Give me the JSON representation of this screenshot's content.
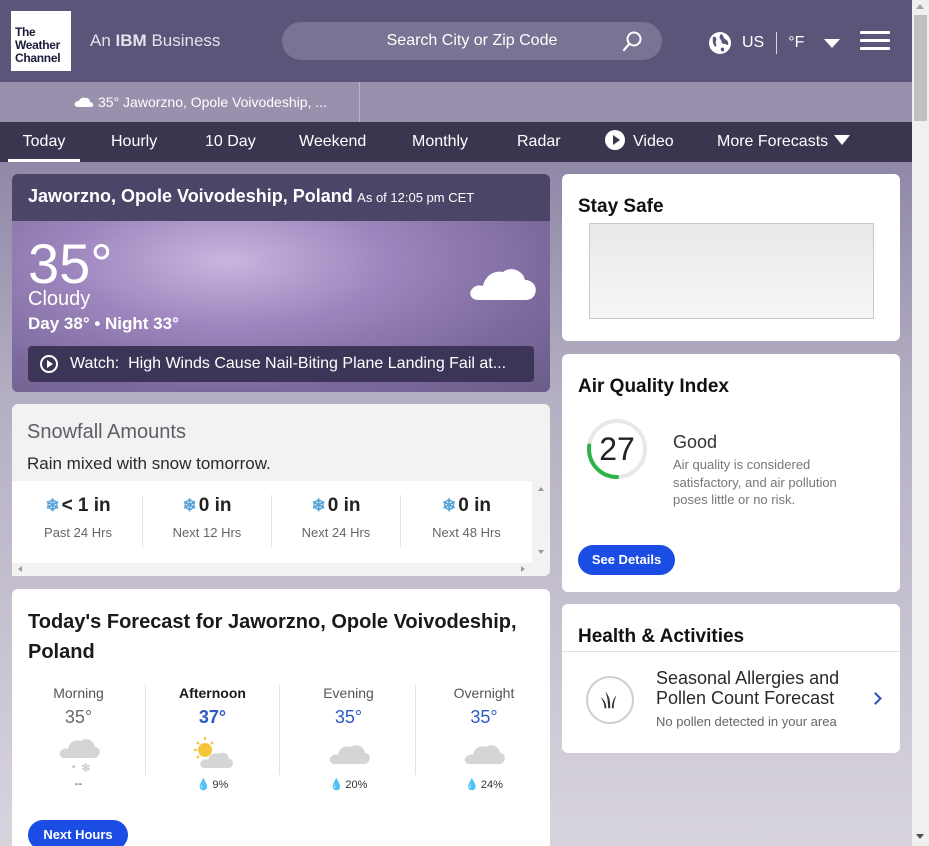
{
  "header": {
    "logo_line1": "The",
    "logo_line2": "Weather",
    "logo_line3": "Channel",
    "tagline_prefix": "An",
    "tagline_brand": "IBM",
    "tagline_suffix": "Business",
    "search_placeholder": "Search City or Zip Code",
    "region": "US",
    "unit": "°F"
  },
  "recent": {
    "label": "35° Jaworzno, Opole Voivodeship, ..."
  },
  "nav": {
    "today": "Today",
    "hourly": "Hourly",
    "ten_day": "10 Day",
    "weekend": "Weekend",
    "monthly": "Monthly",
    "radar": "Radar",
    "video": "Video",
    "more": "More Forecasts"
  },
  "current": {
    "location": "Jaworzno, Opole Voivodeship, Poland",
    "as_of": "As of 12:05 pm CET",
    "temperature": "35°",
    "phrase": "Cloudy",
    "day_night": "Day 38° • Night 33°",
    "watch_prefix": "Watch:",
    "watch_title": "High Winds Cause Nail-Biting Plane Landing Fail at..."
  },
  "snowfall": {
    "title": "Snowfall Amounts",
    "subtitle": "Rain mixed with snow tomorrow.",
    "items": [
      {
        "value": "< 1 in",
        "label": "Past 24 Hrs"
      },
      {
        "value": "0 in",
        "label": "Next 12 Hrs"
      },
      {
        "value": "0 in",
        "label": "Next 24 Hrs"
      },
      {
        "value": "0 in",
        "label": "Next 48 Hrs"
      }
    ]
  },
  "forecast": {
    "title": "Today's Forecast for Jaworzno, Opole Voivodeship, Poland",
    "periods": [
      {
        "name": "Morning",
        "temp": "35°",
        "precip": "--"
      },
      {
        "name": "Afternoon",
        "temp": "37°",
        "precip": "9%"
      },
      {
        "name": "Evening",
        "temp": "35°",
        "precip": "20%"
      },
      {
        "name": "Overnight",
        "temp": "35°",
        "precip": "24%"
      }
    ],
    "button": "Next Hours"
  },
  "stay_safe": {
    "title": "Stay Safe"
  },
  "aqi": {
    "title": "Air Quality Index",
    "value": "27",
    "level": 0.27,
    "category": "Good",
    "description": "Air quality is considered satisfactory, and air pollution poses little or no risk.",
    "button": "See Details",
    "accent": "#2db34a"
  },
  "health": {
    "title": "Health & Activities",
    "item_title": "Seasonal Allergies and Pollen Count Forecast",
    "item_sub": "No pollen detected in your area"
  },
  "colors": {
    "header": "#5d5479",
    "nav": "#3a3650",
    "button": "#1b4de4",
    "temp_blue": "#2c59c5"
  }
}
